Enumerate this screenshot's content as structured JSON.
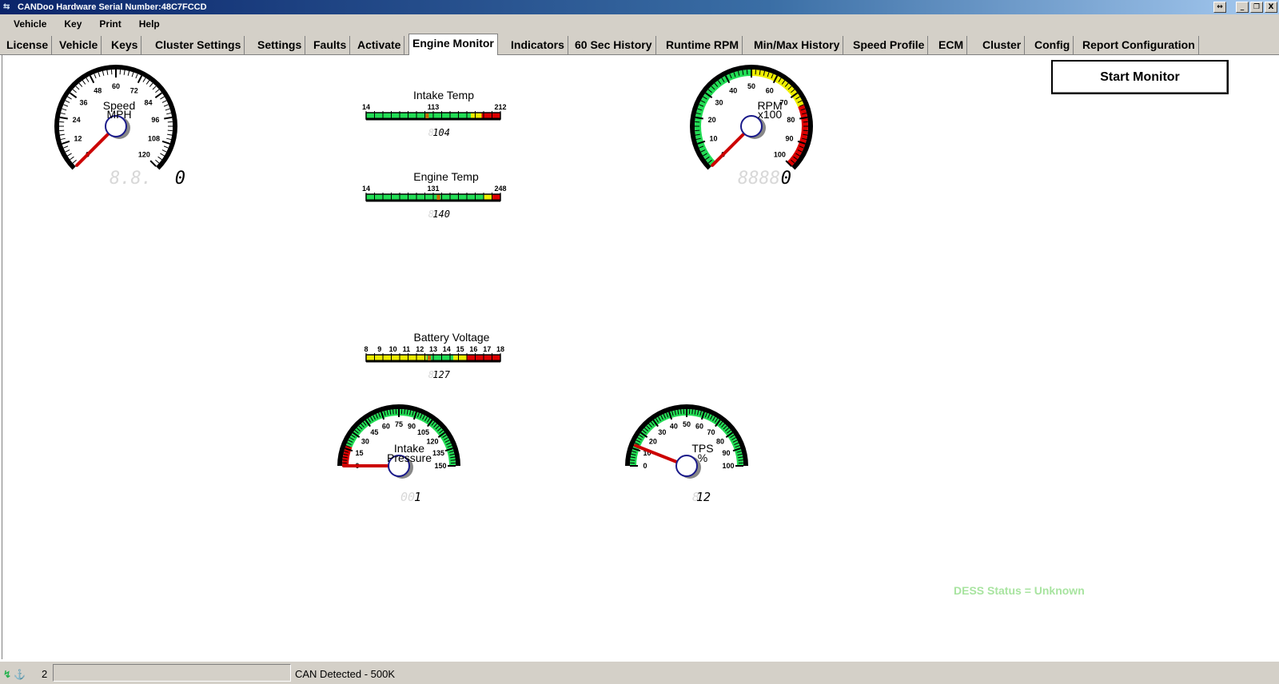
{
  "window": {
    "title": "CANDoo  Hardware Serial Number:48C7FCCD",
    "buttons": [
      "↔",
      "_",
      "❐",
      "X"
    ]
  },
  "menu": [
    "Vehicle",
    "Key",
    "Print",
    "Help"
  ],
  "tabs": [
    "License",
    "Vehicle",
    "Keys",
    "Cluster Settings",
    "Settings",
    "Faults",
    "Activate",
    "Engine Monitor",
    "Indicators",
    "60 Sec History",
    "Runtime RPM",
    "Min/Max History",
    "Speed Profile",
    "ECM",
    "Cluster",
    "Config",
    "Report Configuration"
  ],
  "active_tab": "Engine Monitor",
  "start_monitor_label": "Start Monitor",
  "dess_status": "DESS Status = Unknown",
  "gauges": {
    "speed": {
      "label1": "Speed",
      "label2": "MPH",
      "ticks": [
        "0",
        "12",
        "24",
        "36",
        "48",
        "60",
        "72",
        "84",
        "96",
        "108",
        "120"
      ],
      "value": 0,
      "min": 0,
      "max": 130,
      "readout": "0",
      "readout_ghost": "8.8."
    },
    "rpm": {
      "label1": "RPM",
      "label2": "x100",
      "ticks": [
        "0",
        "10",
        "20",
        "30",
        "40",
        "50",
        "60",
        "70",
        "80",
        "90",
        "100"
      ],
      "value": 0,
      "min": 0,
      "max": 100,
      "readout": "0",
      "readout_ghost": "8888"
    },
    "intake_pressure": {
      "label1": "Intake",
      "label2": "Pressure",
      "ticks": [
        "0",
        "15",
        "30",
        "45",
        "60",
        "75",
        "90",
        "105",
        "120",
        "135",
        "150"
      ],
      "value": 0,
      "min": 0,
      "max": 150,
      "readout": "1",
      "readout_ghost": "00"
    },
    "tps": {
      "label1": "TPS",
      "label2": "%",
      "ticks": [
        "0",
        "10",
        "20",
        "30",
        "40",
        "50",
        "60",
        "70",
        "80",
        "90",
        "100"
      ],
      "value": 12,
      "min": 0,
      "max": 100,
      "readout": "12",
      "readout_ghost": "8"
    }
  },
  "bars": {
    "intake_temp": {
      "label": "Intake Temp",
      "ticks": [
        "14",
        "113",
        "212"
      ],
      "value": 104,
      "readout": "104",
      "readout_ghost": "8"
    },
    "engine_temp": {
      "label": "Engine Temp",
      "ticks": [
        "14",
        "131",
        "248"
      ],
      "value": 140,
      "readout": "140",
      "readout_ghost": "8"
    },
    "battery": {
      "label": "Battery Voltage",
      "ticks": [
        "8",
        "9",
        "10",
        "11",
        "12",
        "13",
        "14",
        "15",
        "16",
        "17",
        "18"
      ],
      "value": 12.7,
      "readout": "127",
      "readout_ghost": "8"
    }
  },
  "statusbar": {
    "icon": "↯ ⚓",
    "count": "2",
    "can": "CAN Detected - 500K"
  },
  "colors": {
    "green": "#22dd55",
    "yellow": "#eeee00",
    "red": "#dd0000",
    "needle": "#cc0000"
  }
}
